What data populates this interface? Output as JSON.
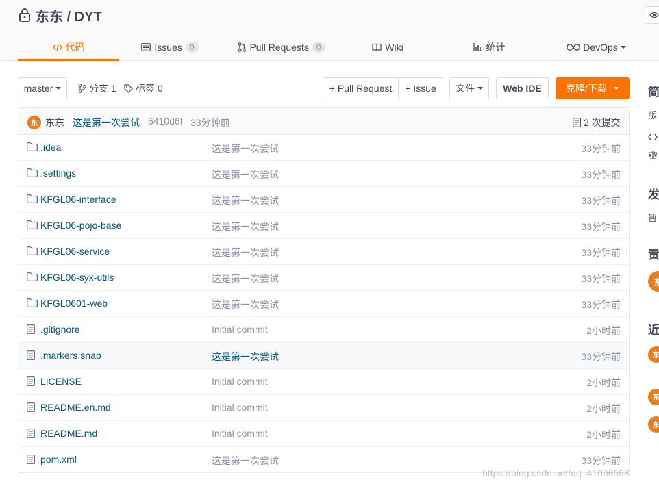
{
  "repo": {
    "title": "东东 / DYT"
  },
  "tabs": [
    {
      "label": "代码"
    },
    {
      "label": "Issues",
      "count": "0"
    },
    {
      "label": "Pull Requests",
      "count": "0"
    },
    {
      "label": "Wiki"
    },
    {
      "label": "统计"
    },
    {
      "label": "DevOps"
    }
  ],
  "toolbar": {
    "branch": "master",
    "branches": "分支 1",
    "tags": "标签 0",
    "pull_request": "+ Pull Request",
    "issue": "+ Issue",
    "file": "文件",
    "web_ide": "Web IDE",
    "clone": "克隆/下载"
  },
  "commit": {
    "avatar": "东",
    "author": "东东",
    "message": "这是第一次尝试",
    "hash": "5410d6f",
    "time": "33分钟前",
    "count": "2 次提交"
  },
  "files": [
    {
      "name": ".idea",
      "type": "folder",
      "message": "这是第一次尝试",
      "time": "33分钟前"
    },
    {
      "name": ".settings",
      "type": "folder",
      "message": "这是第一次尝试",
      "time": "33分钟前"
    },
    {
      "name": "KFGL06-interface",
      "type": "folder",
      "message": "这是第一次尝试",
      "time": "33分钟前"
    },
    {
      "name": "KFGL06-pojo-base",
      "type": "folder",
      "message": "这是第一次尝试",
      "time": "33分钟前"
    },
    {
      "name": "KFGL06-service",
      "type": "folder",
      "message": "这是第一次尝试",
      "time": "33分钟前"
    },
    {
      "name": "KFGL06-syx-utils",
      "type": "folder",
      "message": "这是第一次尝试",
      "time": "33分钟前"
    },
    {
      "name": "KFGL0601-web",
      "type": "folder",
      "message": "这是第一次尝试",
      "time": "33分钟前"
    },
    {
      "name": ".gitignore",
      "type": "file",
      "message": "Initial commit",
      "time": "2小时前"
    },
    {
      "name": ".markers.snap",
      "type": "file",
      "message": "这是第一次尝试",
      "time": "33分钟前"
    },
    {
      "name": "LICENSE",
      "type": "file",
      "message": "Initial commit",
      "time": "2小时前"
    },
    {
      "name": "README.en.md",
      "type": "file",
      "message": "Initial commit",
      "time": "2小时前"
    },
    {
      "name": "README.md",
      "type": "file",
      "message": "Initial commit",
      "time": "2小时前"
    },
    {
      "name": "pom.xml",
      "type": "file",
      "message": "这是第一次尝试",
      "time": "33分钟前"
    }
  ],
  "sidebar": {
    "intro_heading": "简",
    "version_text": "版",
    "release_heading": "发",
    "release_text": "暂",
    "contrib_heading": "贡",
    "recent_heading": "近",
    "avatar": "东"
  },
  "watermark": "https://blog.csdn.net/qq_41096598",
  "colors": {
    "accent": "#fe7300",
    "link": "#005980",
    "muted": "#8c92a4"
  }
}
